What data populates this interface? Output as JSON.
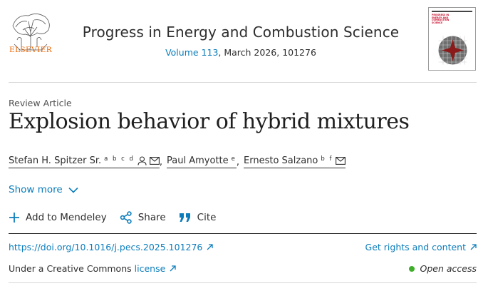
{
  "header": {
    "publisher": "ELSEVIER",
    "journal_title": "Progress in Energy and Combustion Science",
    "volume_link": "Volume 113",
    "issue_rest": ", March 2026, 101276",
    "cover_title": "PROGRESS IN ENERGY AND COMBUSTION SCIENCE"
  },
  "article": {
    "type": "Review Article",
    "title": "Explosion behavior of hybrid mixtures",
    "authors": [
      {
        "name": "Stefan H. Spitzer Sr.",
        "affil": "a b c d"
      },
      {
        "name": "Paul Amyotte",
        "affil": "e"
      },
      {
        "name": "Ernesto Salzano",
        "affil": "b f"
      }
    ],
    "show_more": "Show more"
  },
  "actions": {
    "mendeley": "Add to Mendeley",
    "share": "Share",
    "cite": "Cite"
  },
  "links": {
    "doi": "https://doi.org/10.1016/j.pecs.2025.101276",
    "rights": "Get rights and content",
    "cc_text": "Under a Creative Commons",
    "license": "license",
    "open_access": "Open access"
  },
  "colors": {
    "link": "#0c7dbb",
    "brand_orange": "#eb6500",
    "open_access_dot": "#3fae2a"
  }
}
